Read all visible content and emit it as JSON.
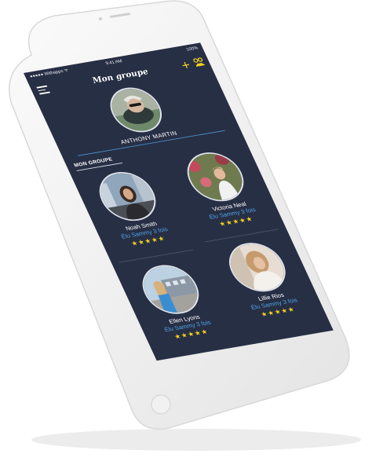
{
  "status_bar": {
    "carrier": "●●●●● Withapps ᯤ",
    "time": "9:41 AM",
    "battery": "100%"
  },
  "nav": {
    "title": "Mon groupe",
    "add_icon": "plus-icon",
    "group_icon": "group-icon",
    "menu_icon": "hamburger-menu-icon"
  },
  "profile": {
    "name": "ANTHONY MARTIN"
  },
  "section": {
    "label": "MON GROUPE"
  },
  "members": [
    {
      "name": "Noah Smith",
      "elu": "Élu Sammy 3 fois",
      "stars": "★★★★★",
      "rating": 5
    },
    {
      "name": "Victoria Neal",
      "elu": "Élu Sammy 3 fois",
      "stars": "★★★★★",
      "rating": 5
    },
    {
      "name": "Ellen Lyons",
      "elu": "Élu Sammy 3 fois",
      "stars": "★★★★★",
      "rating": 5
    },
    {
      "name": "Lillie Rios",
      "elu": "Élu Sammy 3 fois",
      "stars": "★★★★★",
      "rating": 5
    }
  ],
  "colors": {
    "screen_bg": "#272f45",
    "accent_yellow": "#f3d21d",
    "accent_blue": "#4fa3e6"
  }
}
